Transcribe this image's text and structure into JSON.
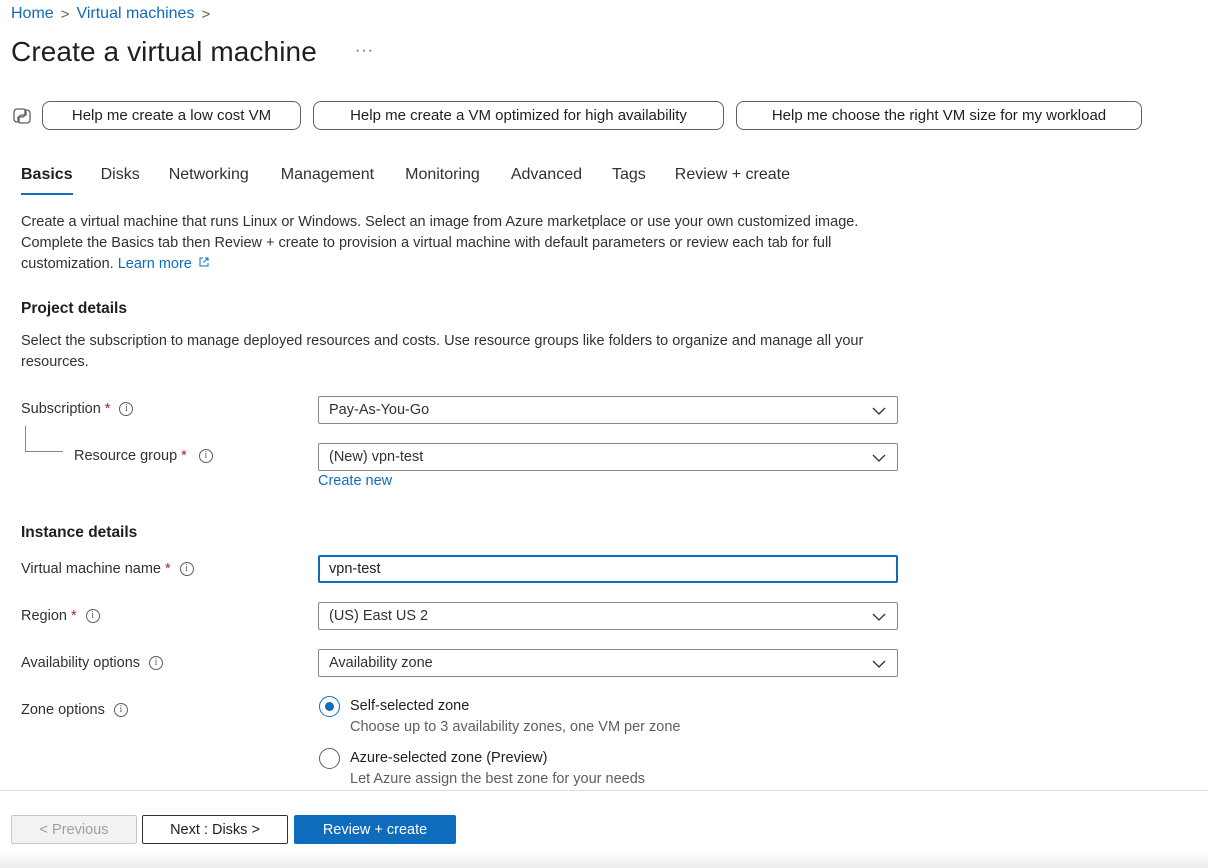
{
  "breadcrumb": {
    "home": "Home",
    "sep1": ">",
    "vms": "Virtual machines",
    "sep2": ">"
  },
  "header": {
    "title": "Create a virtual machine",
    "more": "···"
  },
  "copilot": {
    "icon": "copilot-icon",
    "prompts": [
      "Help me create a low cost VM",
      "Help me create a VM optimized for high availability",
      "Help me choose the right VM size for my workload"
    ]
  },
  "tabs": [
    {
      "label": "Basics",
      "active": true
    },
    {
      "label": "Disks"
    },
    {
      "label": "Networking"
    },
    {
      "label": "Management"
    },
    {
      "label": "Monitoring"
    },
    {
      "label": "Advanced"
    },
    {
      "label": "Tags"
    },
    {
      "label": "Review + create"
    }
  ],
  "intro": {
    "text": "Create a virtual machine that runs Linux or Windows. Select an image from Azure marketplace or use your own customized image. Complete the Basics tab then Review + create to provision a virtual machine with default parameters or review each tab for full customization.",
    "learn_more": "Learn more"
  },
  "project": {
    "heading": "Project details",
    "description": "Select the subscription to manage deployed resources and costs. Use resource groups like folders to organize and manage all your resources.",
    "subscription_label": "Subscription",
    "subscription_value": "Pay-As-You-Go",
    "resource_group_label": "Resource group",
    "resource_group_value": "(New) vpn-test",
    "create_new": "Create new"
  },
  "instance": {
    "heading": "Instance details",
    "vm_name_label": "Virtual machine name",
    "vm_name_value": "vpn-test",
    "region_label": "Region",
    "region_value": "(US) East US 2",
    "availability_label": "Availability options",
    "availability_value": "Availability zone",
    "zone_label": "Zone options",
    "zone_options": [
      {
        "title": "Self-selected zone",
        "desc": "Choose up to 3 availability zones, one VM per zone",
        "checked": true
      },
      {
        "title": "Azure-selected zone (Preview)",
        "desc": "Let Azure assign the best zone for your needs",
        "checked": false
      }
    ]
  },
  "required_mark": "*",
  "info_glyph": "i",
  "footer": {
    "previous": "< Previous",
    "next": "Next : Disks >",
    "review": "Review + create"
  },
  "colors": {
    "accent": "#0f6cbd",
    "required": "#a4262c",
    "text": "#323130"
  }
}
